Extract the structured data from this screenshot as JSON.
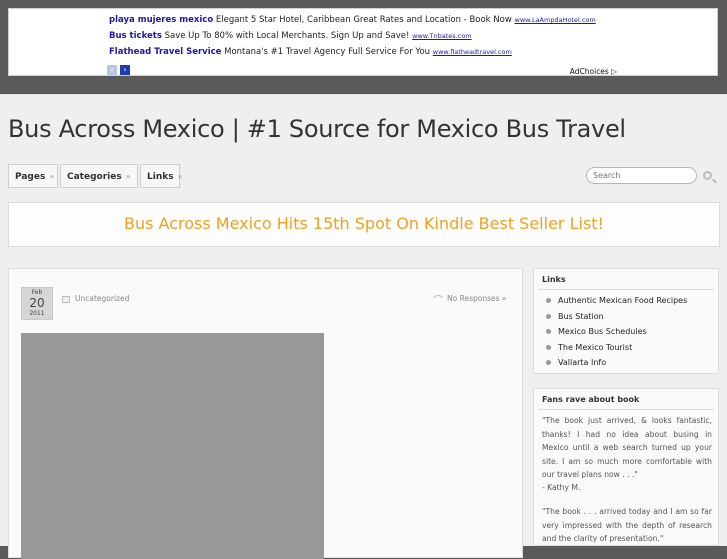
{
  "ads": {
    "items": [
      {
        "title": "playa mujeres mexico",
        "text": "Elegant 5 Star Hotel, Caribbean Great Rates and Location - Book Now",
        "url": "www.LaAmpdaHotel.com"
      },
      {
        "title": "Bus tickets",
        "text": "Save Up To 80% with Local Merchants. Sign Up and Save!",
        "url": "www.Tnbates.com"
      },
      {
        "title": "Flathead Travel Service",
        "text": "Montana's #1 Travel Agency Full Service For You",
        "url": "www.flatheadtravel.com"
      }
    ],
    "prev_icon": "‹",
    "next_icon": "›",
    "adchoices": "AdChoices ▷"
  },
  "site": {
    "title": "Bus Across Mexico | #1 Source for Mexico Bus Travel"
  },
  "nav": {
    "items": [
      {
        "label": "Pages",
        "chev": "»"
      },
      {
        "label": "Categories",
        "chev": "»"
      },
      {
        "label": "Links",
        "chev": "»"
      }
    ]
  },
  "search": {
    "placeholder": "Search"
  },
  "announcement": "Bus Across Mexico Hits 15th Spot On Kindle Best Seller List!",
  "post": {
    "date_month": "Feb",
    "date_day": "20",
    "date_year": "2011",
    "category": "Uncategorized",
    "comments": "No Responses »"
  },
  "sidebar": {
    "links": {
      "title": "Links",
      "items": [
        "Authentic Mexican Food Recipes",
        "Bus Station",
        "Mexico Bus Schedules",
        "The Mexico Tourist",
        "Vallarta Info"
      ]
    },
    "fans": {
      "title": "Fans rave about book",
      "quote1": "\"The book just arrived, & looks fantastic, thanks! I had no idea about busing in Mexico until a web search turned up your site. I am so much more comfortable with our travel plans now . . .\"",
      "author1": "- Kathy M.",
      "quote2": "\"The book . . . arrived today and I am so far very impressed with the depth of research and the clarity of presentation.\""
    }
  },
  "colors": {
    "accent": "#f0a020",
    "ad_link": "#1a1aa6"
  }
}
